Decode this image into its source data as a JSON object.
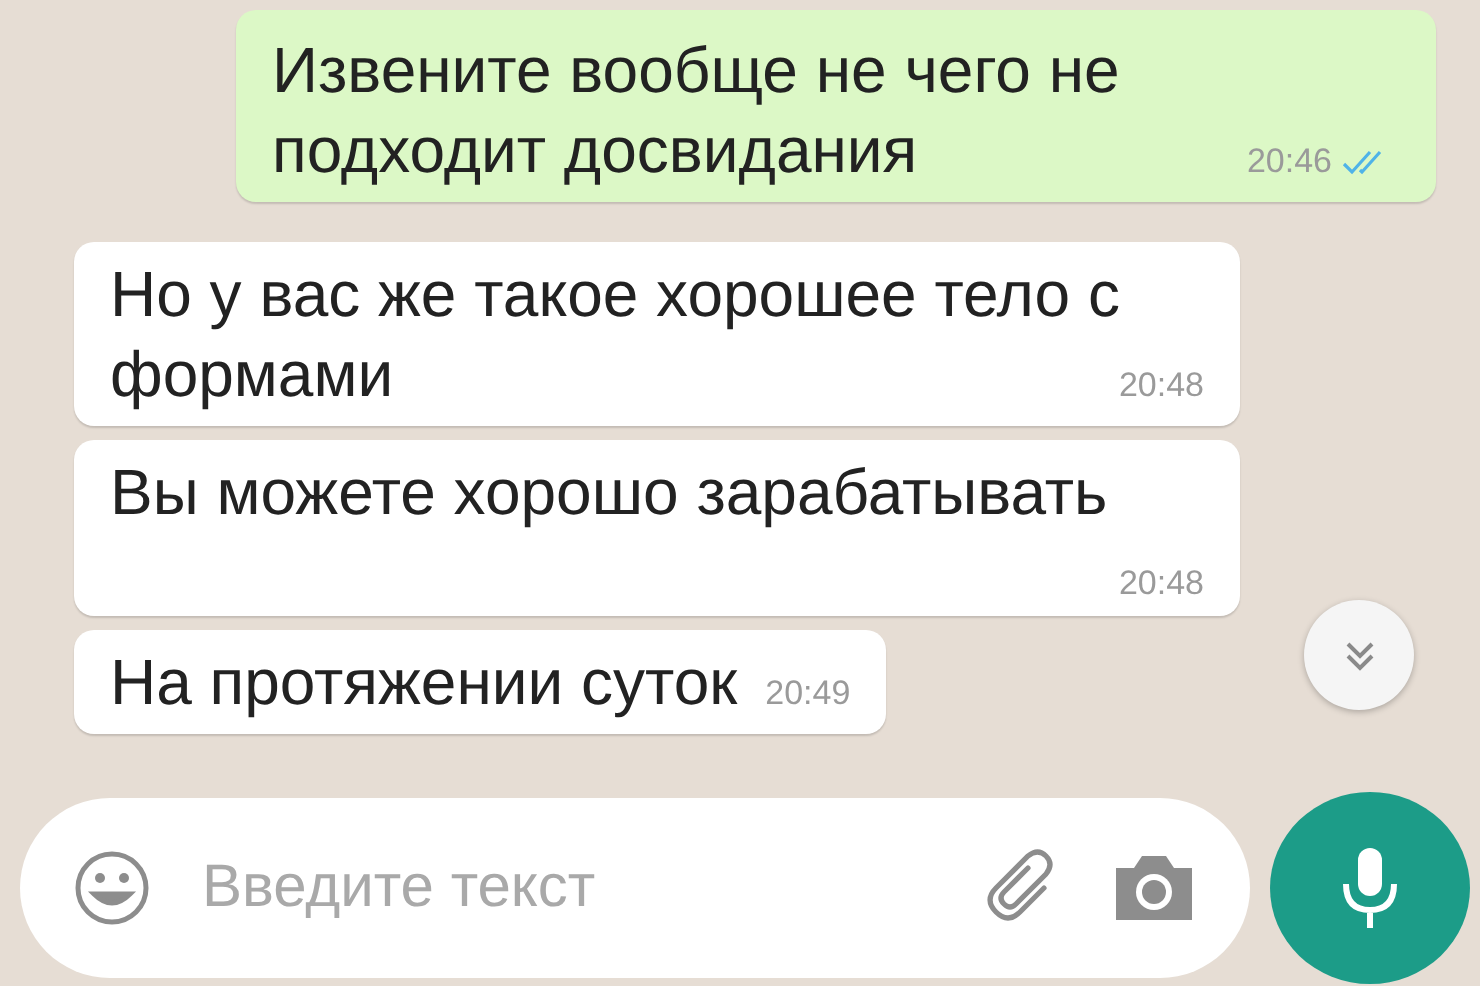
{
  "messages": [
    {
      "kind": "outgoing",
      "text": "Извените вообще не чего не подходит досвидания",
      "time": "20:46",
      "read": true
    },
    {
      "kind": "incoming",
      "text": "Но у вас же такое хорошее тело с формами",
      "time": "20:48"
    },
    {
      "kind": "incoming",
      "text": "Вы можете хорошо зарабатывать",
      "time": "20:48"
    },
    {
      "kind": "incoming",
      "text": "На протяжении суток",
      "time": "20:49"
    }
  ],
  "input": {
    "placeholder": "Введите текст"
  }
}
